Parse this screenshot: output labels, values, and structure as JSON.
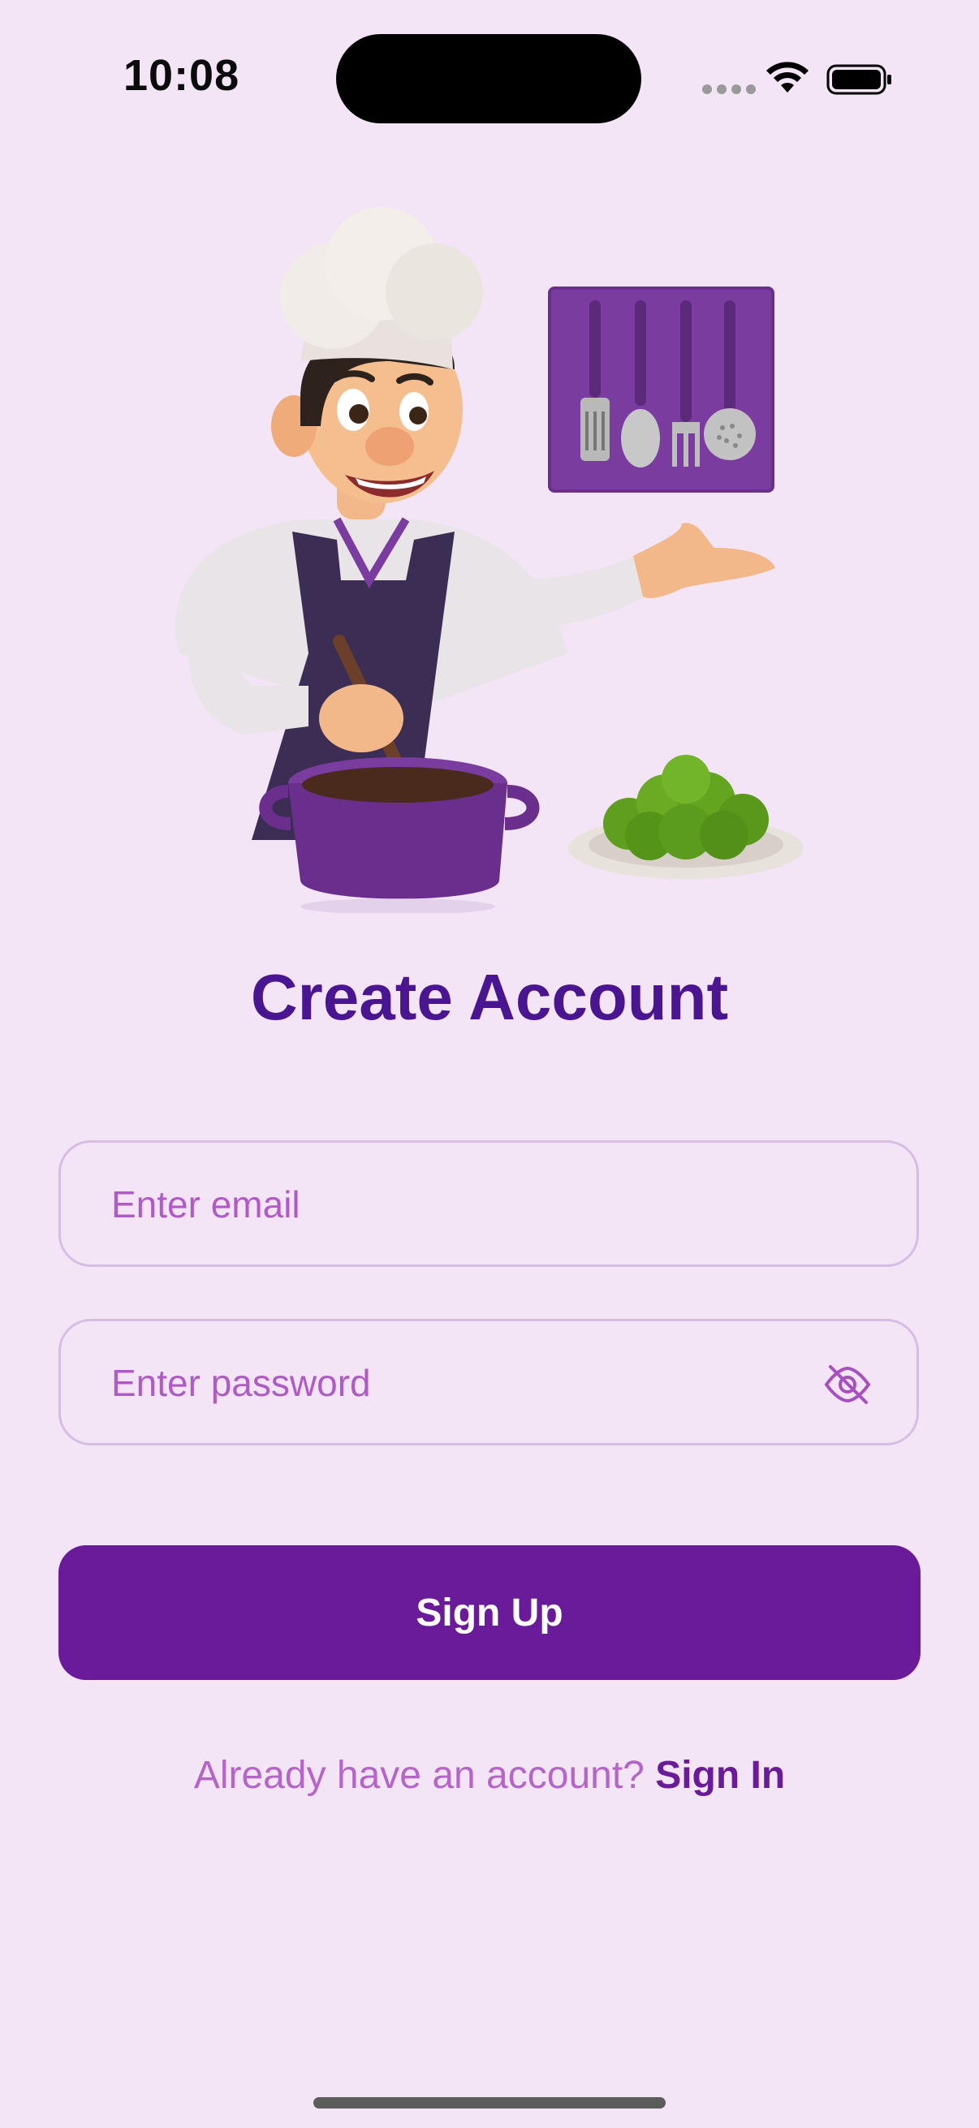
{
  "status_bar": {
    "time": "10:08"
  },
  "title": "Create Account",
  "email": {
    "placeholder": "Enter email",
    "value": ""
  },
  "password": {
    "placeholder": "Enter password",
    "value": "",
    "visibility_icon": "eye-off-icon"
  },
  "signup_button": {
    "label": "Sign Up"
  },
  "signin": {
    "prompt": "Already have an account? ",
    "link_label": "Sign In"
  },
  "colors": {
    "background": "#f3e4f6",
    "accent": "#6a1b9a",
    "title": "#4a1591",
    "placeholder": "#b05ac7"
  }
}
